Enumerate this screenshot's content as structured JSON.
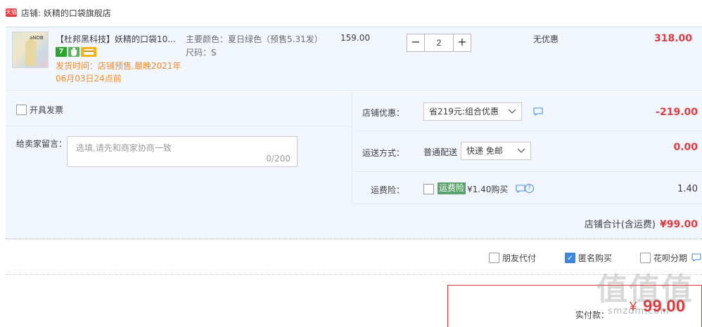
{
  "shop": {
    "badge": "天猫",
    "label": "店铺: 妖精的口袋旗舰店"
  },
  "item": {
    "title": "【杜邦黑科技】妖精的口袋10...",
    "thumb_text": "aNDB",
    "badges": [
      "7",
      "",
      ""
    ],
    "ship_time": "发货时间：店铺预售,最晚2021年06月03日24点前",
    "spec_color": "主要颜色：夏日绿色（预售5.31发）",
    "spec_size": "尺码：S",
    "unit_price": "159.00",
    "quantity": "2",
    "qty_minus": "−",
    "qty_plus": "+",
    "discount": "无优惠",
    "subtotal": "318.00"
  },
  "invoice": {
    "label": "开具发票"
  },
  "message": {
    "label": "给卖家留言：",
    "placeholder": "选填,请先和商家协商一致",
    "count": "0/200"
  },
  "promo": {
    "label": "店铺优惠：",
    "selected": "省219元:组合优惠",
    "value": "-219.00"
  },
  "shipping": {
    "label": "运送方式：",
    "method": "普通配送",
    "selected": "快递 免邮",
    "value": "0.00"
  },
  "insurance": {
    "label": "运费险：",
    "tag": "运费险",
    "price": "¥1.40购买",
    "help": "?",
    "value": "1.40"
  },
  "shop_total": {
    "label": "店铺合计(含运费)",
    "value": "¥99.00"
  },
  "options": {
    "friend_pay": "朋友代付",
    "anonymous": "匿名购买",
    "anonymous_checked": true,
    "huabei": "花呗分期"
  },
  "pay": {
    "label": "实付款：",
    "currency": "¥",
    "amount": "99.00"
  },
  "watermark": {
    "chars": "值值值",
    "url": "smzdm.com"
  },
  "colors": {
    "accent_red": "#e4393c",
    "panel_bg": "#f2f7ff",
    "ship_orange": "#f08c28",
    "link_blue": "#3d86dd"
  }
}
